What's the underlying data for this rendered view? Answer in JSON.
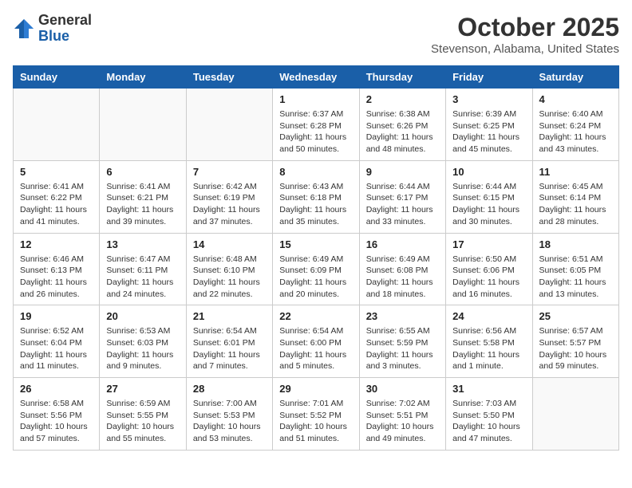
{
  "header": {
    "logo_general": "General",
    "logo_blue": "Blue",
    "month": "October 2025",
    "location": "Stevenson, Alabama, United States"
  },
  "weekdays": [
    "Sunday",
    "Monday",
    "Tuesday",
    "Wednesday",
    "Thursday",
    "Friday",
    "Saturday"
  ],
  "weeks": [
    [
      {
        "day": "",
        "info": ""
      },
      {
        "day": "",
        "info": ""
      },
      {
        "day": "",
        "info": ""
      },
      {
        "day": "1",
        "info": "Sunrise: 6:37 AM\nSunset: 6:28 PM\nDaylight: 11 hours\nand 50 minutes."
      },
      {
        "day": "2",
        "info": "Sunrise: 6:38 AM\nSunset: 6:26 PM\nDaylight: 11 hours\nand 48 minutes."
      },
      {
        "day": "3",
        "info": "Sunrise: 6:39 AM\nSunset: 6:25 PM\nDaylight: 11 hours\nand 45 minutes."
      },
      {
        "day": "4",
        "info": "Sunrise: 6:40 AM\nSunset: 6:24 PM\nDaylight: 11 hours\nand 43 minutes."
      }
    ],
    [
      {
        "day": "5",
        "info": "Sunrise: 6:41 AM\nSunset: 6:22 PM\nDaylight: 11 hours\nand 41 minutes."
      },
      {
        "day": "6",
        "info": "Sunrise: 6:41 AM\nSunset: 6:21 PM\nDaylight: 11 hours\nand 39 minutes."
      },
      {
        "day": "7",
        "info": "Sunrise: 6:42 AM\nSunset: 6:19 PM\nDaylight: 11 hours\nand 37 minutes."
      },
      {
        "day": "8",
        "info": "Sunrise: 6:43 AM\nSunset: 6:18 PM\nDaylight: 11 hours\nand 35 minutes."
      },
      {
        "day": "9",
        "info": "Sunrise: 6:44 AM\nSunset: 6:17 PM\nDaylight: 11 hours\nand 33 minutes."
      },
      {
        "day": "10",
        "info": "Sunrise: 6:44 AM\nSunset: 6:15 PM\nDaylight: 11 hours\nand 30 minutes."
      },
      {
        "day": "11",
        "info": "Sunrise: 6:45 AM\nSunset: 6:14 PM\nDaylight: 11 hours\nand 28 minutes."
      }
    ],
    [
      {
        "day": "12",
        "info": "Sunrise: 6:46 AM\nSunset: 6:13 PM\nDaylight: 11 hours\nand 26 minutes."
      },
      {
        "day": "13",
        "info": "Sunrise: 6:47 AM\nSunset: 6:11 PM\nDaylight: 11 hours\nand 24 minutes."
      },
      {
        "day": "14",
        "info": "Sunrise: 6:48 AM\nSunset: 6:10 PM\nDaylight: 11 hours\nand 22 minutes."
      },
      {
        "day": "15",
        "info": "Sunrise: 6:49 AM\nSunset: 6:09 PM\nDaylight: 11 hours\nand 20 minutes."
      },
      {
        "day": "16",
        "info": "Sunrise: 6:49 AM\nSunset: 6:08 PM\nDaylight: 11 hours\nand 18 minutes."
      },
      {
        "day": "17",
        "info": "Sunrise: 6:50 AM\nSunset: 6:06 PM\nDaylight: 11 hours\nand 16 minutes."
      },
      {
        "day": "18",
        "info": "Sunrise: 6:51 AM\nSunset: 6:05 PM\nDaylight: 11 hours\nand 13 minutes."
      }
    ],
    [
      {
        "day": "19",
        "info": "Sunrise: 6:52 AM\nSunset: 6:04 PM\nDaylight: 11 hours\nand 11 minutes."
      },
      {
        "day": "20",
        "info": "Sunrise: 6:53 AM\nSunset: 6:03 PM\nDaylight: 11 hours\nand 9 minutes."
      },
      {
        "day": "21",
        "info": "Sunrise: 6:54 AM\nSunset: 6:01 PM\nDaylight: 11 hours\nand 7 minutes."
      },
      {
        "day": "22",
        "info": "Sunrise: 6:54 AM\nSunset: 6:00 PM\nDaylight: 11 hours\nand 5 minutes."
      },
      {
        "day": "23",
        "info": "Sunrise: 6:55 AM\nSunset: 5:59 PM\nDaylight: 11 hours\nand 3 minutes."
      },
      {
        "day": "24",
        "info": "Sunrise: 6:56 AM\nSunset: 5:58 PM\nDaylight: 11 hours\nand 1 minute."
      },
      {
        "day": "25",
        "info": "Sunrise: 6:57 AM\nSunset: 5:57 PM\nDaylight: 10 hours\nand 59 minutes."
      }
    ],
    [
      {
        "day": "26",
        "info": "Sunrise: 6:58 AM\nSunset: 5:56 PM\nDaylight: 10 hours\nand 57 minutes."
      },
      {
        "day": "27",
        "info": "Sunrise: 6:59 AM\nSunset: 5:55 PM\nDaylight: 10 hours\nand 55 minutes."
      },
      {
        "day": "28",
        "info": "Sunrise: 7:00 AM\nSunset: 5:53 PM\nDaylight: 10 hours\nand 53 minutes."
      },
      {
        "day": "29",
        "info": "Sunrise: 7:01 AM\nSunset: 5:52 PM\nDaylight: 10 hours\nand 51 minutes."
      },
      {
        "day": "30",
        "info": "Sunrise: 7:02 AM\nSunset: 5:51 PM\nDaylight: 10 hours\nand 49 minutes."
      },
      {
        "day": "31",
        "info": "Sunrise: 7:03 AM\nSunset: 5:50 PM\nDaylight: 10 hours\nand 47 minutes."
      },
      {
        "day": "",
        "info": ""
      }
    ]
  ]
}
